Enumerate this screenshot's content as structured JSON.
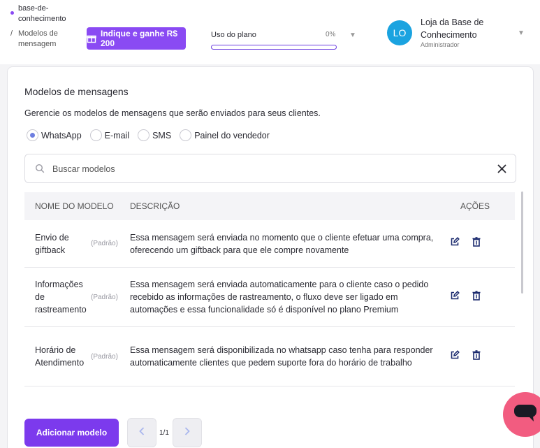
{
  "breadcrumb": {
    "parent": "base-de-conhecimento",
    "separator": "/",
    "current": "Modelos de mensagem"
  },
  "header": {
    "refer_label": "Indique e ganhe R$ 200",
    "plan_label": "Uso do plano",
    "plan_percent": "0%",
    "plan_usage_fraction": 0,
    "user_initials": "LO",
    "store_name": "Loja da Base de Conhecimento",
    "user_role": "Administrador"
  },
  "page": {
    "title": "Modelos de mensagens",
    "subtitle": "Gerencie os modelos de mensagens que serão enviados para seus clientes."
  },
  "channels": [
    {
      "label": "WhatsApp",
      "selected": true
    },
    {
      "label": "E-mail",
      "selected": false
    },
    {
      "label": "SMS",
      "selected": false
    },
    {
      "label": "Painel do vendedor",
      "selected": false
    }
  ],
  "search": {
    "placeholder": "Buscar modelos",
    "value": ""
  },
  "table": {
    "columns": [
      "NOME DO MODELO",
      "DESCRIÇÃO",
      "AÇÕES"
    ],
    "rows": [
      {
        "name": "Envio de giftback",
        "tag": "(Padrão)",
        "description": "Essa mensagem será enviada no momento que o cliente efetuar uma compra, oferecendo um giftback para que ele compre novamente"
      },
      {
        "name": "Informações de rastreamento",
        "tag": "(Padrão)",
        "description": "Essa mensagem será enviada automaticamente para o cliente caso o pedido recebido as informações de rastreamento, o fluxo deve ser ligado em automações e essa funcionalidade só é disponível no plano Premium"
      },
      {
        "name": "Horário de Atendimento",
        "tag": "(Padrão)",
        "description": "Essa mensagem será disponibilizada no whatsapp caso tenha para responder automaticamente clientes que pedem suporte fora do horário de trabalho"
      }
    ]
  },
  "footer": {
    "add_label": "Adicionar modelo",
    "page_indicator": "1/1"
  },
  "colors": {
    "accent": "#8a4af3",
    "primary_button": "#7c3aed",
    "avatar": "#1aa3e0",
    "chat": "#f25c80"
  },
  "icons": {
    "edit": "edit-icon",
    "delete": "trash-icon",
    "search": "search-icon",
    "clear": "close-icon",
    "gift": "gift-icon",
    "chat": "chat-icon"
  }
}
